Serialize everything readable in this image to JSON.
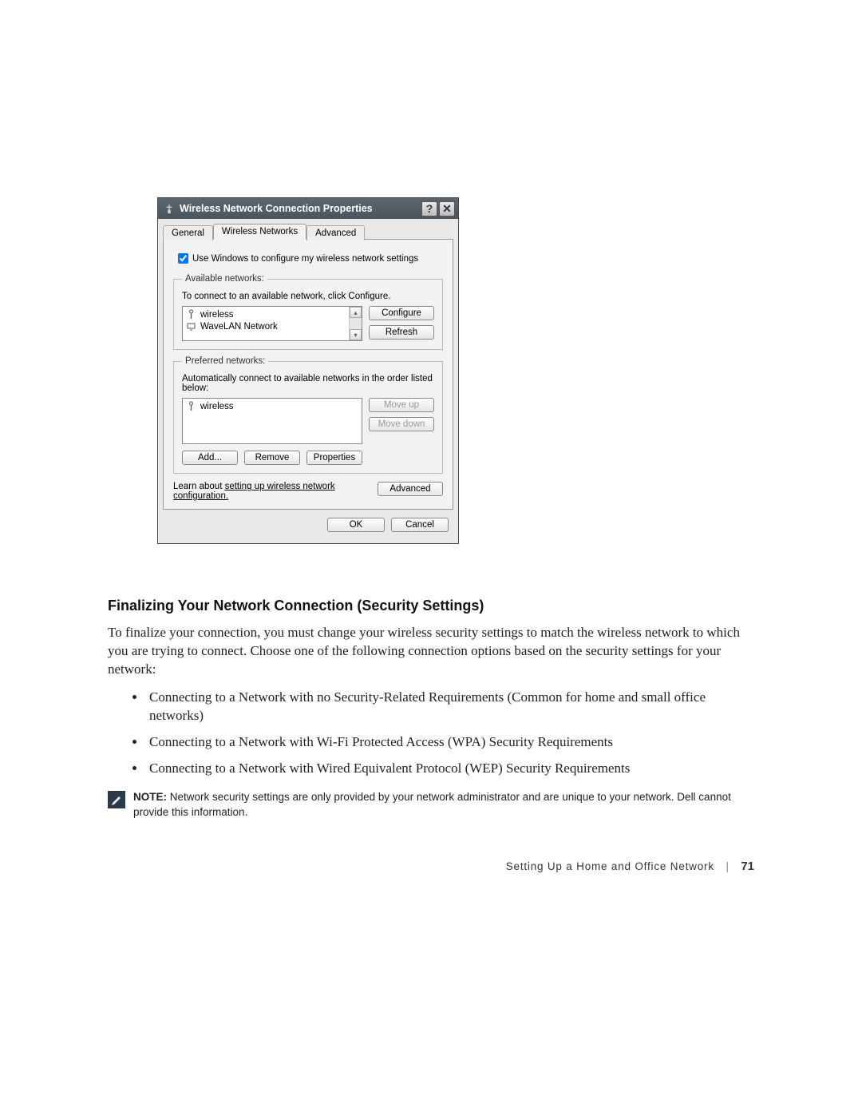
{
  "dialog": {
    "title": "Wireless Network Connection Properties",
    "help_label": "?",
    "close_label": "✕",
    "tabs": {
      "general": "General",
      "wireless": "Wireless Networks",
      "advanced": "Advanced"
    },
    "checkbox_label": "Use Windows to configure my wireless network settings",
    "available": {
      "legend": "Available networks:",
      "hint": "To connect to an available network, click Configure.",
      "items": [
        "wireless",
        "WaveLAN Network"
      ],
      "configure_btn": "Configure",
      "refresh_btn": "Refresh"
    },
    "preferred": {
      "legend": "Preferred networks:",
      "hint": "Automatically connect to available networks in the order listed below:",
      "items": [
        "wireless"
      ],
      "moveup_btn": "Move up",
      "movedown_btn": "Move down",
      "add_btn": "Add...",
      "remove_btn": "Remove",
      "properties_btn": "Properties"
    },
    "learn_prefix": "Learn about ",
    "learn_link": "setting up wireless network configuration.",
    "advanced_btn": "Advanced",
    "ok_btn": "OK",
    "cancel_btn": "Cancel"
  },
  "doc": {
    "heading": "Finalizing Your Network Connection (Security Settings)",
    "para": "To finalize your connection, you must change your wireless security settings to match the wireless network to which you are trying to connect. Choose one of the following connection options based on the security settings for your network:",
    "bullets": [
      "Connecting to a Network with no Security-Related Requirements (Common for home and small office networks)",
      "Connecting to a Network with Wi-Fi Protected Access (WPA) Security Requirements",
      "Connecting to a Network with Wired Equivalent Protocol (WEP) Security Requirements"
    ],
    "note_label": "NOTE:",
    "note_text": " Network security settings are only provided by your network administrator and are unique to your network. Dell cannot provide this information."
  },
  "footer": {
    "section": "Setting Up a Home and Office Network",
    "page": "71"
  }
}
